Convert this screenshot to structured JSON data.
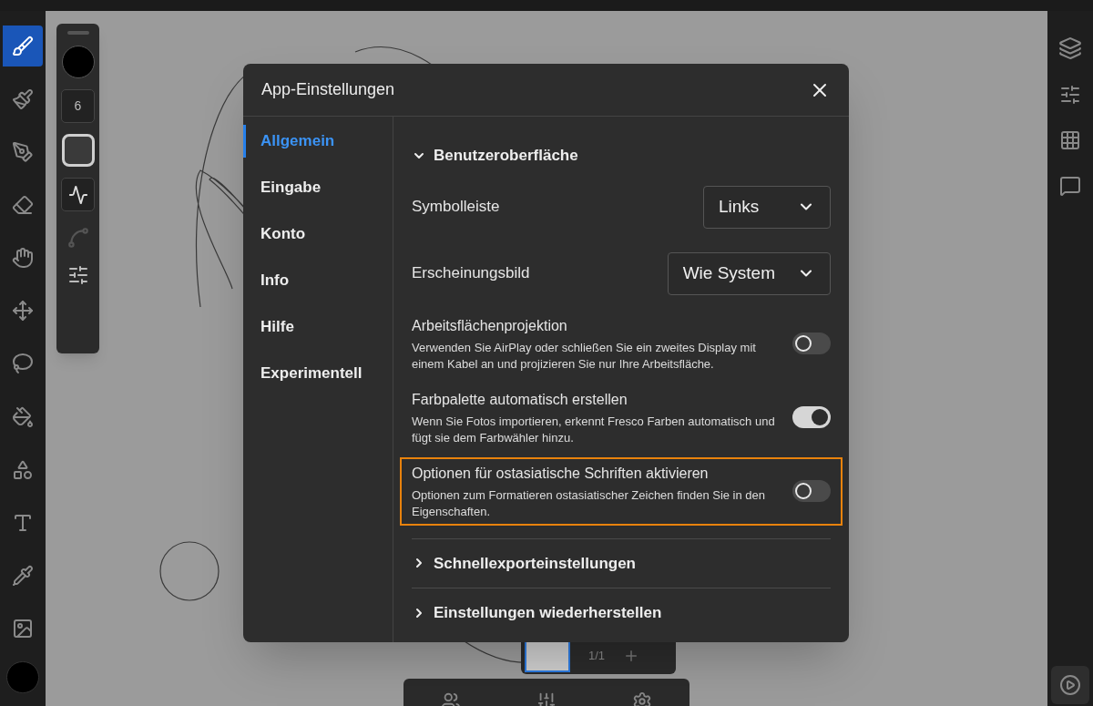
{
  "left_toolbar": {
    "tools": [
      {
        "kind": "pixel-brush",
        "selected": true
      },
      {
        "kind": "live-brush",
        "selected": false
      },
      {
        "kind": "vector-brush",
        "selected": false
      },
      {
        "kind": "eraser",
        "selected": false
      },
      {
        "kind": "smudge",
        "selected": false
      },
      {
        "kind": "move",
        "selected": false
      },
      {
        "kind": "lasso",
        "selected": false
      },
      {
        "kind": "fill",
        "selected": false
      },
      {
        "kind": "shapes",
        "selected": false
      },
      {
        "kind": "text",
        "selected": false
      },
      {
        "kind": "eyedropper",
        "selected": false
      },
      {
        "kind": "image",
        "selected": false
      }
    ]
  },
  "brush_panel": {
    "size": "6"
  },
  "dialog": {
    "title": "App-Einstellungen",
    "nav": [
      {
        "label": "Allgemein",
        "selected": true
      },
      {
        "label": "Eingabe",
        "selected": false
      },
      {
        "label": "Konto",
        "selected": false
      },
      {
        "label": "Info",
        "selected": false
      },
      {
        "label": "Hilfe",
        "selected": false
      },
      {
        "label": "Experimentell",
        "selected": false
      }
    ],
    "sections": [
      {
        "title": "Benutzeroberfläche",
        "expanded": true,
        "settings": [
          {
            "kind": "dropdown",
            "label": "Symbolleiste",
            "value": "Links"
          },
          {
            "kind": "dropdown",
            "label": "Erscheinungsbild",
            "value": "Wie System"
          },
          {
            "kind": "toggle",
            "label": "Arbeitsflächenprojektion",
            "description": "Verwenden Sie AirPlay oder schließen Sie ein zweites Display mit einem Kabel an und projizieren Sie nur Ihre Arbeitsfläche.",
            "on": false,
            "highlighted": false
          },
          {
            "kind": "toggle",
            "label": "Farbpalette automatisch erstellen",
            "description": "Wenn Sie Fotos importieren, erkennt Fresco Farben automatisch und fügt sie dem Farbwähler hinzu.",
            "on": true,
            "highlighted": false
          },
          {
            "kind": "toggle",
            "label": "Optionen für ostasiatische Schriften aktivieren",
            "description": "Optionen zum Formatieren ostasiatischer Zeichen finden Sie in den Eigenschaften.",
            "on": false,
            "highlighted": true
          }
        ]
      },
      {
        "title": "Schnellexporteinstellungen",
        "expanded": false
      },
      {
        "title": "Einstellungen wiederherstellen",
        "expanded": false
      }
    ]
  },
  "layers_panel": {
    "count": "1/1"
  }
}
